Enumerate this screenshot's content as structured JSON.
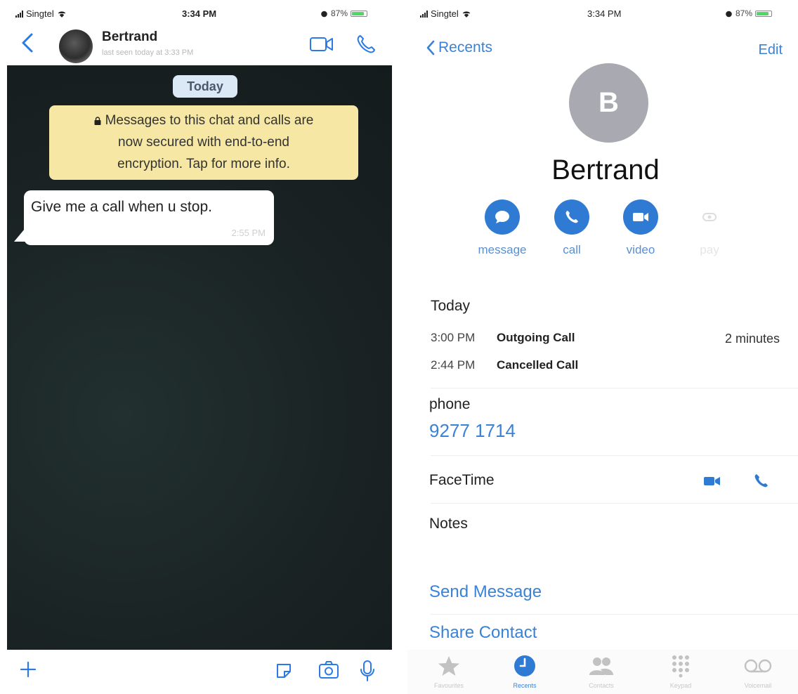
{
  "left": {
    "status": {
      "carrier": "Singtel",
      "time": "3:34 PM",
      "battery": "87%"
    },
    "header": {
      "contact_name": "Bertrand",
      "last_seen": "last seen today at 3:33 PM"
    },
    "date_pill": "Today",
    "encryption_notice": {
      "line1": "Messages to this chat and calls are",
      "line2": "now secured with end-to-end",
      "line3": "encryption. Tap for more info."
    },
    "message": {
      "text": "Give me a call when u stop.",
      "time": "2:55 PM"
    },
    "colors": {
      "accent": "#2c7be5",
      "chat_bg": "#1b2425",
      "notice_bg": "#f6e7a4",
      "pill_bg": "#dbe9f7"
    },
    "toolbar_icons": [
      "plus-icon",
      "sticker-icon",
      "camera-icon",
      "microphone-icon"
    ]
  },
  "right": {
    "status": {
      "carrier": "Singtel",
      "time": "3:34 PM",
      "battery": "87%"
    },
    "nav": {
      "back_label": "Recents",
      "edit_label": "Edit"
    },
    "avatar_initial": "B",
    "name": "Bertrand",
    "actions": [
      {
        "label": "message",
        "icon": "message-icon",
        "enabled": true
      },
      {
        "label": "call",
        "icon": "phone-icon",
        "enabled": true
      },
      {
        "label": "video",
        "icon": "video-icon",
        "enabled": true
      },
      {
        "label": "pay",
        "icon": "pay-icon",
        "enabled": false
      }
    ],
    "recents": {
      "header": "Today",
      "calls": [
        {
          "time": "3:00 PM",
          "kind": "Outgoing Call",
          "duration": "2 minutes"
        },
        {
          "time": "2:44 PM",
          "kind": "Cancelled Call",
          "duration": ""
        }
      ]
    },
    "phone": {
      "label": "phone",
      "number": "9277 1714"
    },
    "facetime_label": "FaceTime",
    "notes_label": "Notes",
    "send_message": "Send Message",
    "share_contact": "Share Contact",
    "tabbar": [
      {
        "label": "Favourites",
        "icon": "star-icon",
        "active": false
      },
      {
        "label": "Recents",
        "icon": "clock-icon",
        "active": true
      },
      {
        "label": "Contacts",
        "icon": "contacts-icon",
        "active": false
      },
      {
        "label": "Keypad",
        "icon": "keypad-icon",
        "active": false
      },
      {
        "label": "Voicemail",
        "icon": "voicemail-icon",
        "active": false
      }
    ],
    "colors": {
      "accent": "#3a82d6",
      "action_circle": "#2f7bd4",
      "avatar": "#a9a9b2"
    }
  }
}
